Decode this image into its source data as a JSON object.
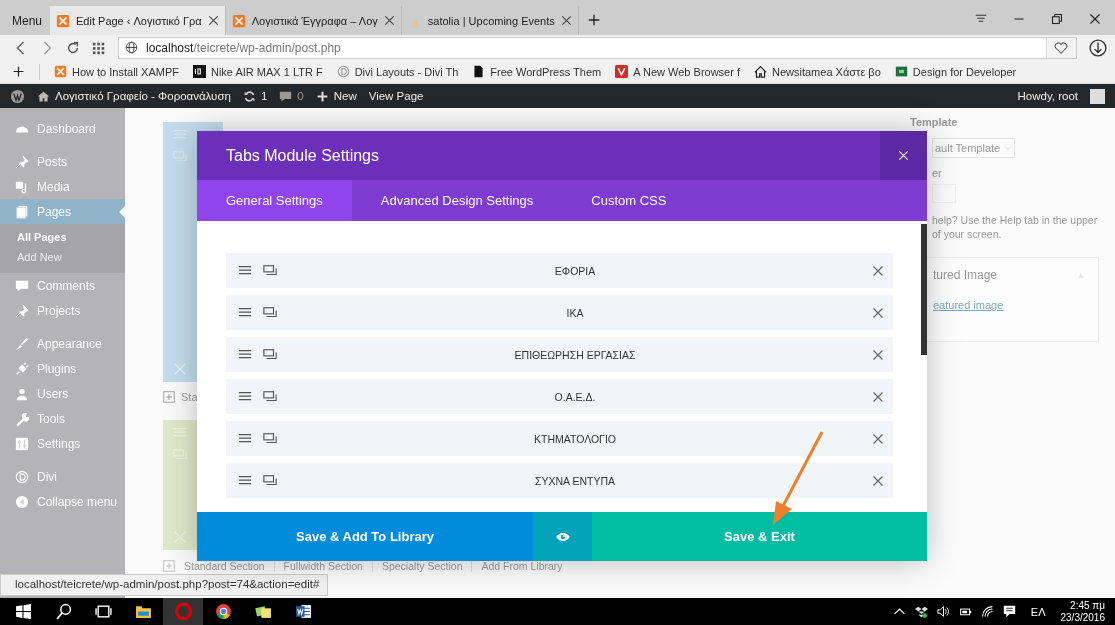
{
  "browser": {
    "menu": "Menu",
    "tabs": [
      {
        "title": "Edit Page ‹ Λογιστικό Γρα",
        "kind": "xampp",
        "selected": true
      },
      {
        "title": "Λογιστικά Έγγραφα – Λογ",
        "kind": "xampp",
        "selected": false
      },
      {
        "title": "satolia | Upcoming Events",
        "kind": "figure",
        "selected": false
      }
    ],
    "address": {
      "host": "localhost",
      "path": "/teicrete/wp-admin/post.php"
    },
    "bookmarks": [
      {
        "label": "How to Install XAMPF",
        "kind": "xampp"
      },
      {
        "label": "Nike AIR MAX 1 LTR F",
        "kind": "nike"
      },
      {
        "label": "Divi Layouts - Divi Th",
        "kind": "divi"
      },
      {
        "label": "Free WordPress Them",
        "kind": "page"
      },
      {
        "label": "A New Web Browser f",
        "kind": "vivaldi"
      },
      {
        "label": "Newsitamea Χάστε βο",
        "kind": "house"
      },
      {
        "label": "Design for Developer",
        "kind": "design"
      }
    ]
  },
  "admin_bar": {
    "site": "Λογιστικό Γραφείο - Φοροανάλυση",
    "updates": "1",
    "comments": "0",
    "new": "New",
    "view": "View Page",
    "howdy": "Howdy, root"
  },
  "sidebar": {
    "groups": [
      [
        {
          "label": "Dashboard",
          "kind": "dashboard",
          "selected": false
        }
      ],
      [
        {
          "label": "Posts",
          "kind": "pin",
          "selected": false
        },
        {
          "label": "Media",
          "kind": "media",
          "selected": false
        },
        {
          "label": "Pages",
          "kind": "pages",
          "selected": true,
          "children": [
            {
              "label": "All Pages",
              "selected": true
            },
            {
              "label": "Add New",
              "selected": false
            }
          ]
        },
        {
          "label": "Comments",
          "kind": "comment",
          "selected": false
        },
        {
          "label": "Projects",
          "kind": "pin",
          "selected": false
        }
      ],
      [
        {
          "label": "Appearance",
          "kind": "brush",
          "selected": false
        },
        {
          "label": "Plugins",
          "kind": "plug",
          "selected": false
        },
        {
          "label": "Users",
          "kind": "user",
          "selected": false
        },
        {
          "label": "Tools",
          "kind": "wrench",
          "selected": false
        },
        {
          "label": "Settings",
          "kind": "settings",
          "selected": false
        }
      ],
      [
        {
          "label": "Divi",
          "kind": "divi",
          "selected": false
        },
        {
          "label": "Collapse menu",
          "kind": "collapse",
          "selected": false
        }
      ]
    ]
  },
  "builder": {
    "section_start": "Sta",
    "section_links": [
      "Standard Section",
      "Fullwidth Section",
      "Specialty Section",
      "Add From Library"
    ]
  },
  "right_panel": {
    "template_label": "Template",
    "template_value": "ault Template",
    "field_label": "er",
    "help_lines": [
      "help? Use the Help tab in the upper",
      "of your screen."
    ],
    "featured_title": "tured Image",
    "featured_link": "eatured image"
  },
  "modal": {
    "title": "Tabs Module Settings",
    "tabs": [
      {
        "label": "General Settings",
        "selected": true
      },
      {
        "label": "Advanced Design Settings",
        "selected": false
      },
      {
        "label": "Custom CSS",
        "selected": false
      }
    ],
    "items": [
      "ΕΦΟΡΙΑ",
      "ΙΚΑ",
      "ΕΠΙΘΕΩΡΗΣΗ ΕΡΓΑΣΙΑΣ",
      "Ο.Α.Ε.Δ.",
      "ΚΤΗΜΑΤΟΛΟΓΙΟ",
      "ΣΥΧΝΑ ΕΝΤΥΠΑ"
    ],
    "save_library": "Save & Add To Library",
    "save_exit": "Save & Exit"
  },
  "status_url": "localhost/teicrete/wp-admin/post.php?post=74&action=edit#",
  "taskbar": {
    "apps": [
      {
        "kind": "explorer",
        "active": false
      },
      {
        "kind": "opera",
        "active": true
      },
      {
        "kind": "chrome",
        "active": false
      },
      {
        "kind": "notes",
        "active": false
      },
      {
        "kind": "word",
        "active": false
      }
    ],
    "language": "ΕΛ",
    "time": "2:45 πμ",
    "date": "23/3/2016"
  }
}
